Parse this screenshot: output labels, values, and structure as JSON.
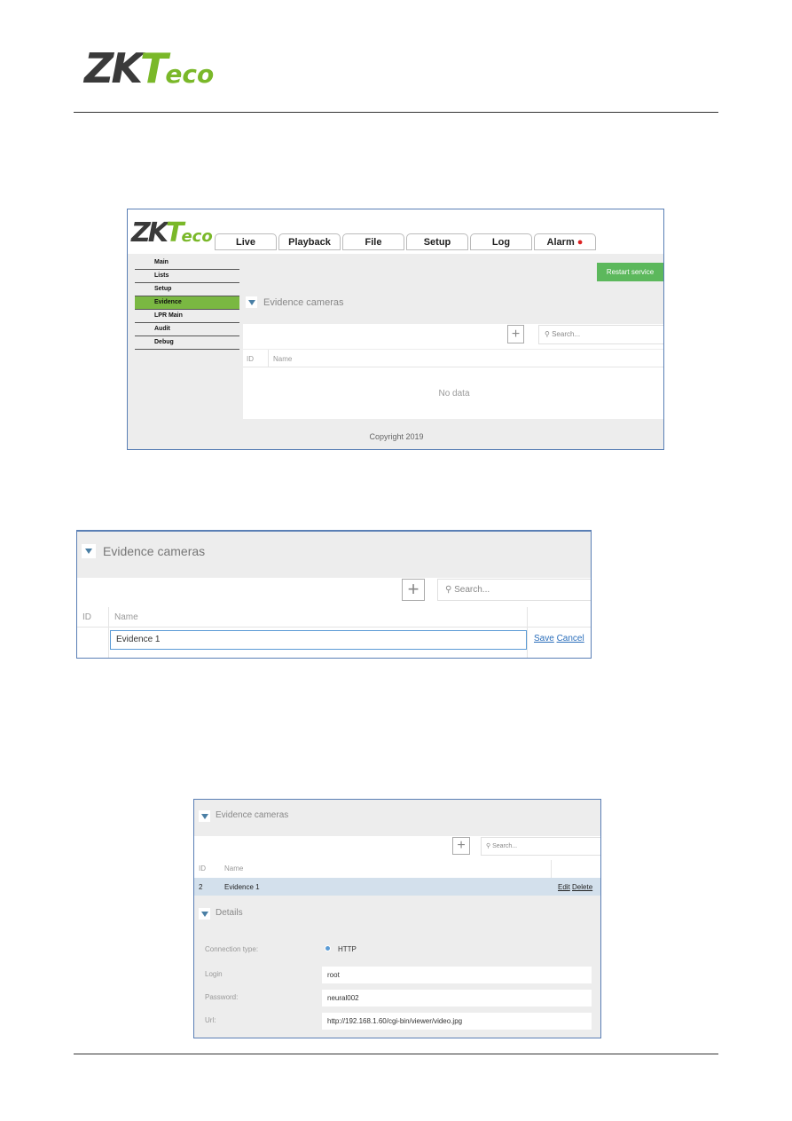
{
  "page_logo": {
    "zk": "ZK",
    "t": "T",
    "eco": "eco"
  },
  "shot1": {
    "logo": {
      "zk": "ZK",
      "t": "T",
      "eco": "eco"
    },
    "tabs": [
      "Live",
      "Playback",
      "File",
      "Setup",
      "Log",
      "Alarm"
    ],
    "sidebar": [
      "Main",
      "Lists",
      "Setup",
      "Evidence",
      "LPR Main",
      "Audit",
      "Debug"
    ],
    "active_sidebar": "Evidence",
    "restart_button": "Restart service",
    "section_title": "Evidence cameras",
    "search_placeholder": "Search...",
    "columns": [
      "ID",
      "Name"
    ],
    "empty": "No data",
    "footer": "Copyright 2019",
    "accent": "#7ab842"
  },
  "shot2": {
    "section_title": "Evidence cameras",
    "search_placeholder": "Search...",
    "columns": [
      "ID",
      "Name"
    ],
    "name_input": "Evidence 1",
    "save": "Save",
    "cancel": "Cancel"
  },
  "shot3": {
    "section_title": "Evidence cameras",
    "search_placeholder": "Search...",
    "columns": [
      "ID",
      "Name"
    ],
    "row": {
      "id": "2",
      "name": "Evidence 1",
      "edit": "Edit",
      "delete": "Delete"
    },
    "details_title": "Details",
    "connection_label": "Connection type:",
    "connection_value": "HTTP",
    "login_label": "Login",
    "login_value": "root",
    "password_label": "Password:",
    "password_value": "neural002",
    "url_label": "Url:",
    "url_value": "http://192.168.1.60/cgi-bin/viewer/video.jpg"
  }
}
